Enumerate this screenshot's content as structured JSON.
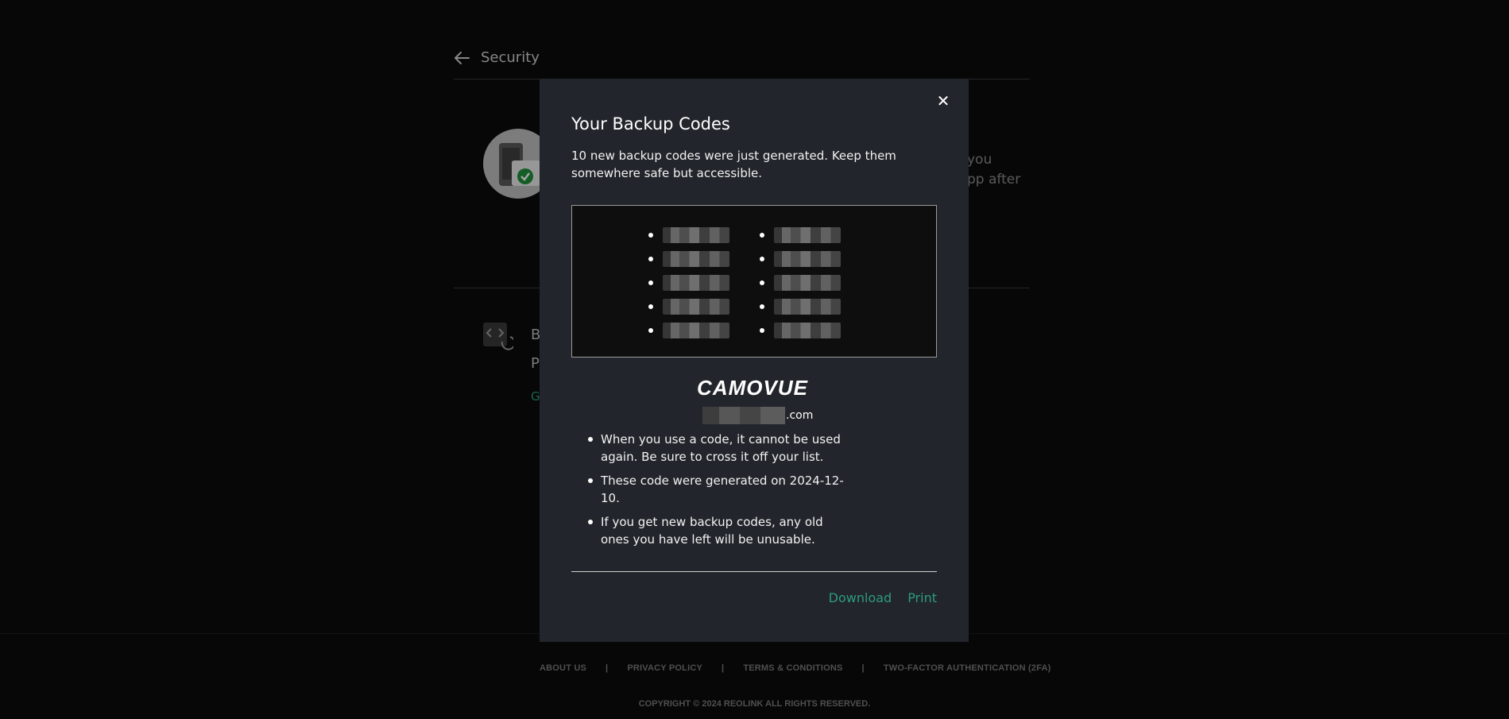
{
  "header": {
    "title": "Security"
  },
  "background": {
    "right_text_line1": "you",
    "right_text_line2": "pp after",
    "section2_line1": "B",
    "section2_line2": "P",
    "section2_link": "Ge"
  },
  "modal": {
    "title": "Your Backup Codes",
    "description": "10 new backup codes were just generated. Keep them somewhere safe but accessible.",
    "code_count": 10,
    "brand": "CAMOVUE",
    "email_suffix": ".com",
    "notes": [
      "When you use a code, it cannot be used again. Be sure to cross it off your list.",
      "These code were generated on 2024-12-10.",
      "If you get new backup codes, any old ones you have left will be unusable."
    ],
    "download_label": "Download",
    "print_label": "Print",
    "close_glyph": "✕"
  },
  "footer": {
    "links": [
      "ABOUT US",
      "PRIVACY POLICY",
      "TERMS & CONDITIONS",
      "TWO-FACTOR AUTHENTICATION (2FA)"
    ],
    "separator": "|",
    "copyright": "COPYRIGHT © 2024 REOLINK ALL RIGHTS RESERVED."
  },
  "colors": {
    "accent": "#2e9b7e",
    "modal_bg": "#22252b",
    "page_bg": "#0b0b0b"
  }
}
